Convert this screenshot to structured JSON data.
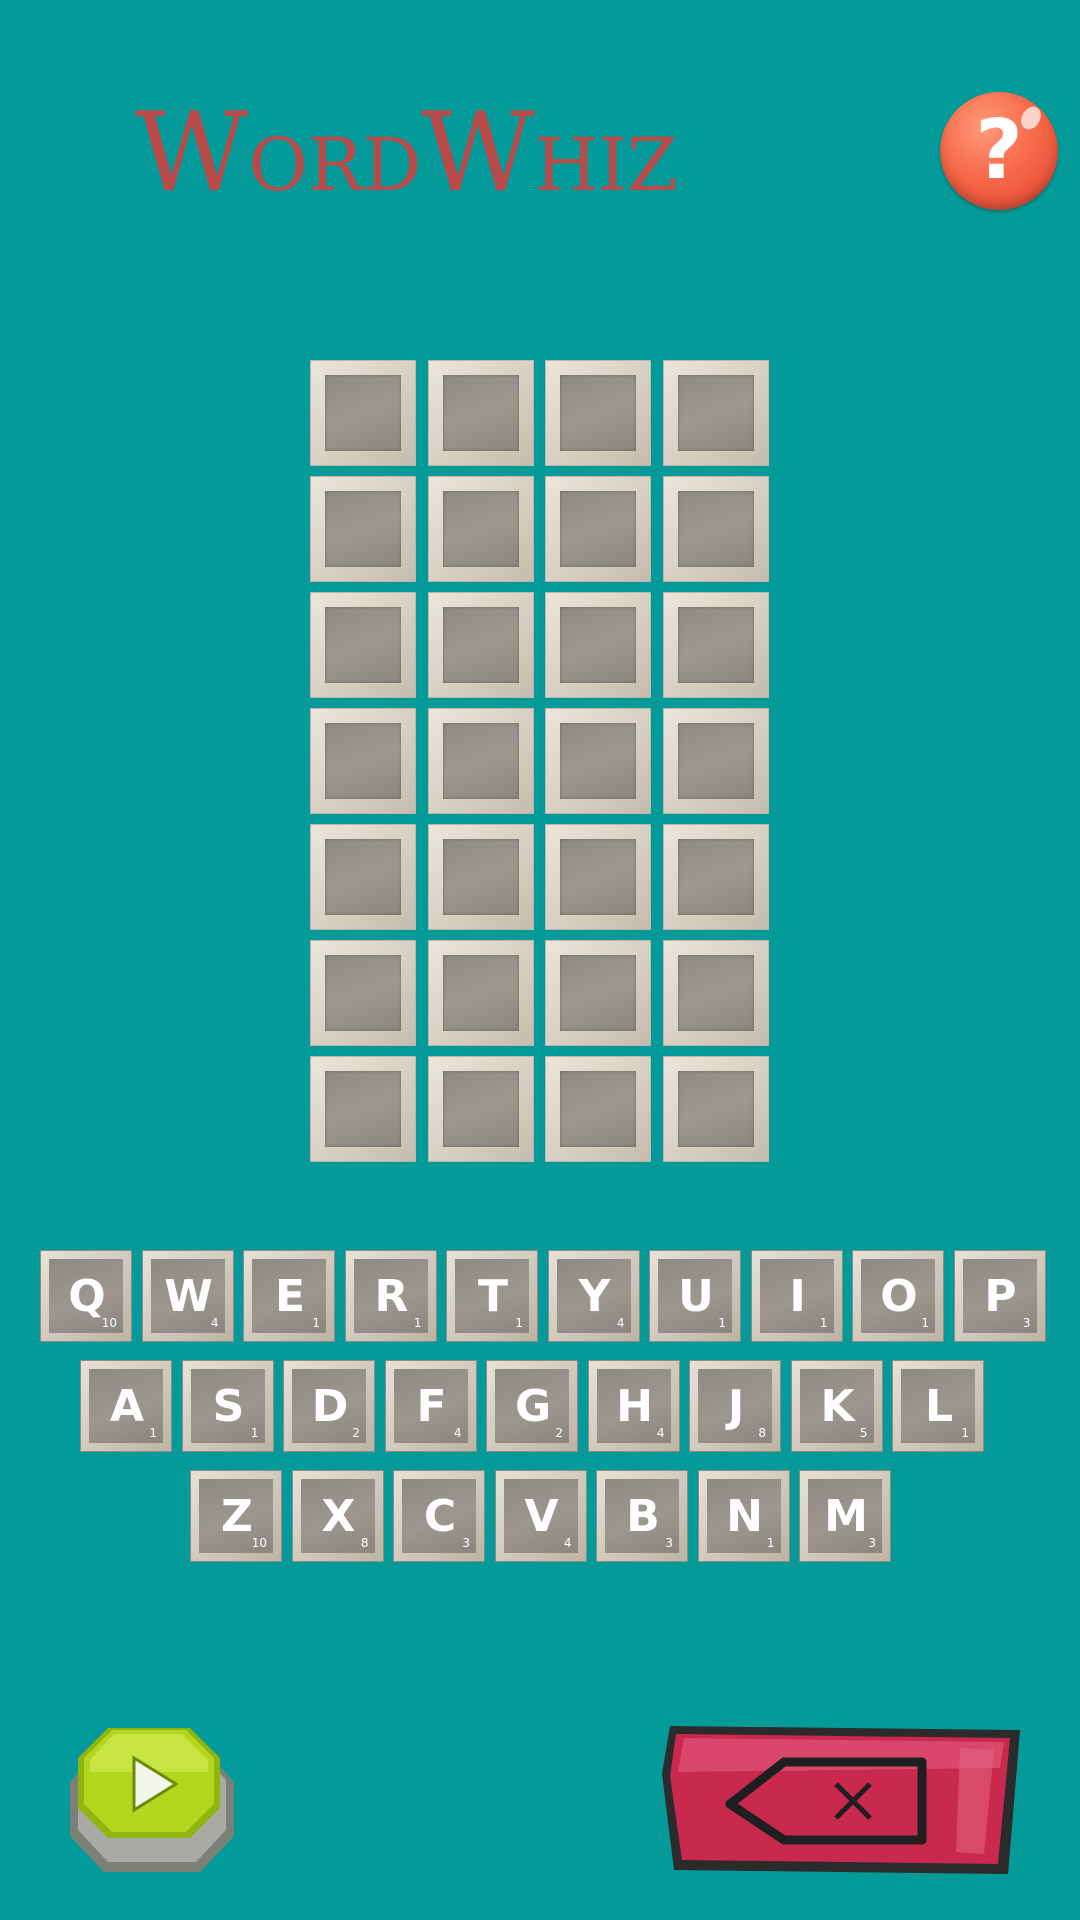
{
  "app": {
    "title": "WordWhiz"
  },
  "board": {
    "rows": 7,
    "cols": 4
  },
  "keyboard": {
    "rows": [
      [
        {
          "letter": "Q",
          "score": "10"
        },
        {
          "letter": "W",
          "score": "4"
        },
        {
          "letter": "E",
          "score": "1"
        },
        {
          "letter": "R",
          "score": "1"
        },
        {
          "letter": "T",
          "score": "1"
        },
        {
          "letter": "Y",
          "score": "4"
        },
        {
          "letter": "U",
          "score": "1"
        },
        {
          "letter": "I",
          "score": "1"
        },
        {
          "letter": "O",
          "score": "1"
        },
        {
          "letter": "P",
          "score": "3"
        }
      ],
      [
        {
          "letter": "A",
          "score": "1"
        },
        {
          "letter": "S",
          "score": "1"
        },
        {
          "letter": "D",
          "score": "2"
        },
        {
          "letter": "F",
          "score": "4"
        },
        {
          "letter": "G",
          "score": "2"
        },
        {
          "letter": "H",
          "score": "4"
        },
        {
          "letter": "J",
          "score": "8"
        },
        {
          "letter": "K",
          "score": "5"
        },
        {
          "letter": "L",
          "score": "1"
        }
      ],
      [
        {
          "letter": "Z",
          "score": "10"
        },
        {
          "letter": "X",
          "score": "8"
        },
        {
          "letter": "C",
          "score": "3"
        },
        {
          "letter": "V",
          "score": "4"
        },
        {
          "letter": "B",
          "score": "3"
        },
        {
          "letter": "N",
          "score": "1"
        },
        {
          "letter": "M",
          "score": "3"
        }
      ]
    ]
  },
  "buttons": {
    "help_glyph": "?",
    "help_icon": "question-mark-icon",
    "enter_icon": "play-arrow-icon",
    "delete_icon": "backspace-icon"
  },
  "colors": {
    "background": "#049a9a",
    "title": "#b94a4a",
    "help": "#f76a4a",
    "enter": "#b5d61e",
    "delete": "#c9284f"
  }
}
